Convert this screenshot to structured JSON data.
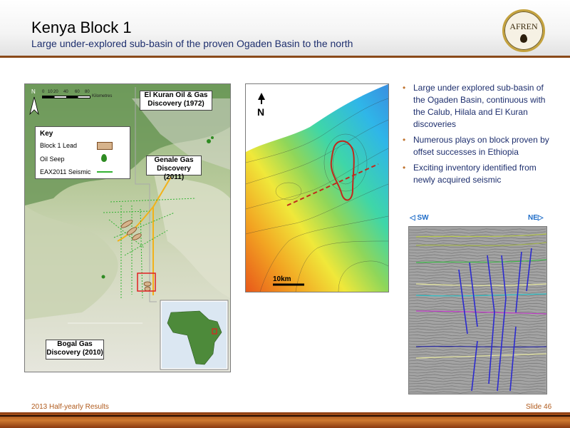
{
  "header": {
    "title": "Kenya Block 1",
    "subtitle": "Large under-explored sub-basin of the proven Ogaden Basin to the north",
    "logo_text": "AFREN"
  },
  "map1": {
    "scale_ticks": [
      "0",
      "10",
      "20",
      "40",
      "60",
      "80"
    ],
    "scale_unit": "Kilometres",
    "north_label": "N",
    "callouts": {
      "el_kuran": [
        "El Kuran Oil & Gas",
        "Discovery (1972)"
      ],
      "genale": [
        "Genale Gas",
        "Discovery (2011)"
      ],
      "bogal": [
        "Bogal Gas",
        "Discovery (2010)"
      ]
    },
    "key": {
      "title": "Key",
      "items": [
        "Block 1 Lead",
        "Oil Seep",
        "EAX2011 Seismic"
      ]
    },
    "colors": {
      "lead_fill": "#d6b38c",
      "oil_seep": "#2e8b22",
      "seismic": "#33b233"
    }
  },
  "map2": {
    "north_label": "N",
    "scale_label": "10km"
  },
  "bullets": [
    "Large under explored sub-basin of the Ogaden Basin, continuous with the Calub, Hilala and El Kuran discoveries",
    "Numerous plays on block proven by offset successes in Ethiopia",
    "Exciting inventory identified from newly acquired seismic"
  ],
  "seismic": {
    "sw_label": "SW",
    "ne_label": "NE"
  },
  "footer": {
    "left": "2013 Half-yearly Results",
    "right": "Slide 46"
  },
  "theme": {
    "accent_brown": "#8a4a1a",
    "subtitle_blue": "#1e2f6e",
    "bullet_orange": "#c0732e"
  }
}
